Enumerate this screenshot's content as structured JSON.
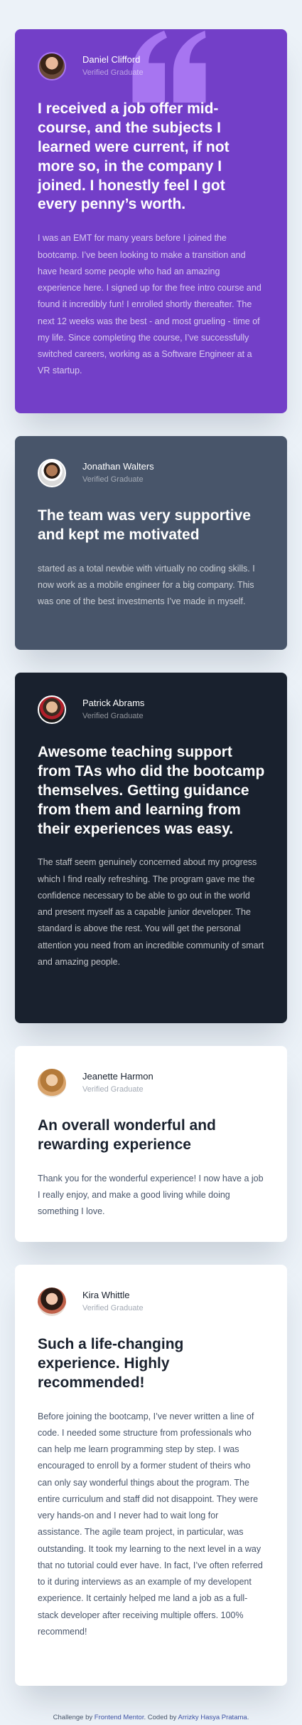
{
  "testimonials": [
    {
      "name": "Daniel Clifford",
      "role": "Verified Graduate",
      "headline": "I received a job offer mid-course, and the subjects I learned were current, if not more so, in the company I joined. I honestly feel I got every penny’s worth.",
      "body": "I was an EMT for many years before I joined the bootcamp. I’ve been looking to make a transition and have heard some people who had an amazing experience here. I signed up for the free intro course and found it incredibly fun! I enrolled shortly thereafter. The next 12 weeks was the best - and most grueling - time of my life. Since completing the course, I’ve successfully switched careers, working as a Software Engineer at a VR startup.",
      "background": "#733fc8"
    },
    {
      "name": "Jonathan Walters",
      "role": "Verified Graduate",
      "headline": "The team was very supportive and kept me motivated",
      "body": "started as a total newbie with virtually no coding skills. I now work as a mobile engineer for a big company. This was one of the best investments I’ve made in myself.",
      "background": "#48556a"
    },
    {
      "name": "Patrick Abrams",
      "role": "Verified Graduate",
      "headline": "Awesome teaching support from TAs who did the bootcamp themselves. Getting guidance from them and learning from their experiences was easy.",
      "body": "The staff seem genuinely concerned about my progress which I find really refreshing. The program gave me the confidence necessary to be able to go out in the world and present myself as a capable junior developer. The standard is above the rest. You will get the personal attention you need from an incredible community of smart and amazing people.",
      "background": "#19212e"
    },
    {
      "name": "Jeanette Harmon",
      "role": "Verified Graduate",
      "headline": "An overall wonderful and rewarding experience",
      "body": "Thank you for the wonderful experience! I now have a job I really enjoy, and make a good living while doing something I love.",
      "background": "#ffffff"
    },
    {
      "name": "Kira Whittle",
      "role": "Verified Graduate",
      "headline": "Such a life-changing experience. Highly recommended!",
      "body": "Before joining the bootcamp, I’ve never written a line of code. I needed some structure from professionals who can help me learn programming step by step. I was encouraged to enroll by a former student of theirs who can only say wonderful things about the program. The entire curriculum and staff did not disappoint. They were very hands-on and I never had to wait long for assistance. The agile team project, in particular, was outstanding. It took my learning to the next level in a way that no tutorial could ever have. In fact, I’ve often referred to it during interviews as an example of my developent experience. It certainly helped me land a job as a full-stack developer after receiving multiple offers. 100% recommend!",
      "background": "#ffffff"
    }
  ],
  "footer": {
    "prefix": "Challenge by ",
    "challenge_link": "Frontend Mentor",
    "middle": ". Coded by ",
    "author_link": "Arrizky Hasya Pratama",
    "suffix": "."
  },
  "icons": {
    "quote": "quote-icon"
  },
  "colors": {
    "page_background": "#ecf2f8",
    "purple": "#733fc8",
    "gray_blue": "#48556a",
    "dark_blue": "#19212e",
    "white": "#ffffff",
    "quote_mark": "#a775f1"
  }
}
